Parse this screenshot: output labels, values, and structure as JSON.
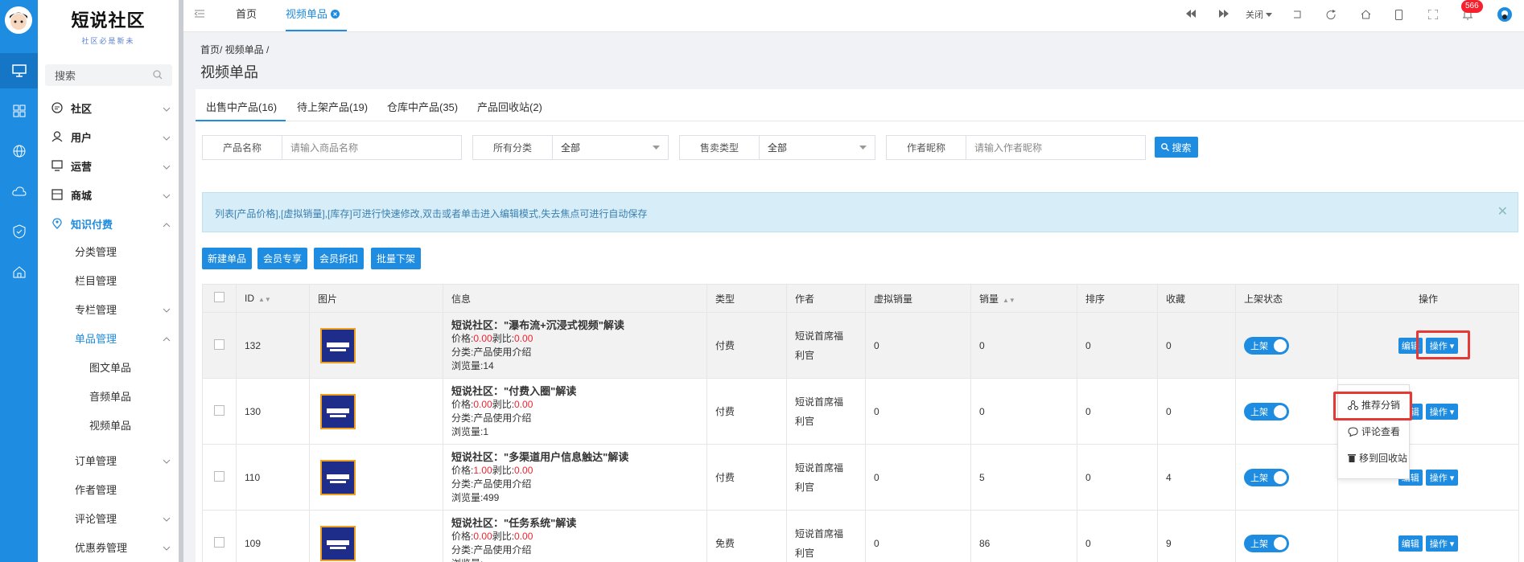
{
  "app": {
    "logo_title": "短说社区",
    "logo_slogan": "社区必是新未"
  },
  "sidebar": {
    "search_placeholder": "搜索",
    "items": [
      {
        "label": "社区",
        "icon": "chat-icon"
      },
      {
        "label": "用户",
        "icon": "user-icon"
      },
      {
        "label": "运营",
        "icon": "monitor-icon"
      },
      {
        "label": "商城",
        "icon": "shop-icon"
      },
      {
        "label": "知识付费",
        "icon": "location-icon"
      }
    ],
    "sub": [
      "分类管理",
      "栏目管理",
      "专栏管理",
      "单品管理"
    ],
    "sub3": [
      "图文单品",
      "音频单品",
      "视频单品"
    ],
    "after": [
      "订单管理",
      "作者管理",
      "评论管理",
      "优惠券管理"
    ]
  },
  "topbar": {
    "tabs": [
      "首页",
      "视频单品"
    ],
    "close_label": "关闭",
    "notify_count": "566"
  },
  "breadcrumb": "首页/ 视频单品 /",
  "page_title": "视频单品",
  "status_tabs": [
    "出售中产品(16)",
    "待上架产品(19)",
    "仓库中产品(35)",
    "产品回收站(2)"
  ],
  "filters": {
    "name_label": "产品名称",
    "name_placeholder": "请输入商品名称",
    "cat_label": "所有分类",
    "cat_value": "全部",
    "sale_label": "售卖类型",
    "sale_value": "全部",
    "author_label": "作者昵称",
    "author_placeholder": "请输入作者昵称",
    "search_btn": "搜索"
  },
  "alert": "列表[产品价格],[虚拟销量],[库存]可进行快速修改,双击或者单击进入编辑模式,失去焦点可进行自动保存",
  "actions": [
    "新建单品",
    "会员专享",
    "会员折扣",
    "批量下架"
  ],
  "table": {
    "headers": [
      "ID",
      "图片",
      "信息",
      "类型",
      "作者",
      "虚拟销量",
      "销量",
      "排序",
      "收藏",
      "上架状态",
      "操作"
    ],
    "rows": [
      {
        "id": "132",
        "title": "短说社区：\"瀑布流+沉浸式视频\"解读",
        "price": "0.00",
        "ratio": "0.00",
        "price_label": "价格:",
        "ratio_label": "剥比:",
        "cat": "分类:产品使用介绍",
        "views": "浏览量:14",
        "type": "付费",
        "author": "短说首席福利官",
        "virtual": "0",
        "sales": "0",
        "sort": "0",
        "fav": "0",
        "status": "上架"
      },
      {
        "id": "130",
        "title": "短说社区：\"付费入圈\"解读",
        "price": "0.00",
        "ratio": "0.00",
        "price_label": "价格:",
        "ratio_label": "剥比:",
        "cat": "分类:产品使用介绍",
        "views": "浏览量:1",
        "type": "付费",
        "author": "短说首席福利官",
        "virtual": "0",
        "sales": "0",
        "sort": "0",
        "fav": "0",
        "status": "上架"
      },
      {
        "id": "110",
        "title": "短说社区：\"多渠道用户信息触达\"解读",
        "price": "1.00",
        "ratio": "0.00",
        "price_label": "价格:",
        "ratio_label": "剥比:",
        "cat": "分类:产品使用介绍",
        "views": "浏览量:499",
        "type": "付费",
        "author": "短说首席福利官",
        "virtual": "0",
        "sales": "5",
        "sort": "0",
        "fav": "4",
        "status": "上架"
      },
      {
        "id": "109",
        "title": "短说社区：\"任务系统\"解读",
        "price": "0.00",
        "ratio": "0.00",
        "price_label": "价格:",
        "ratio_label": "剥比:",
        "cat": "分类:产品使用介绍",
        "views": "浏览量:",
        "type": "免费",
        "author": "短说首席福利官",
        "virtual": "0",
        "sales": "86",
        "sort": "0",
        "fav": "9",
        "status": "上架"
      }
    ],
    "edit_label": "编辑",
    "ops_label": "操作"
  },
  "dropdown": [
    "推荐分销",
    "评论查看",
    "移到回收站"
  ]
}
